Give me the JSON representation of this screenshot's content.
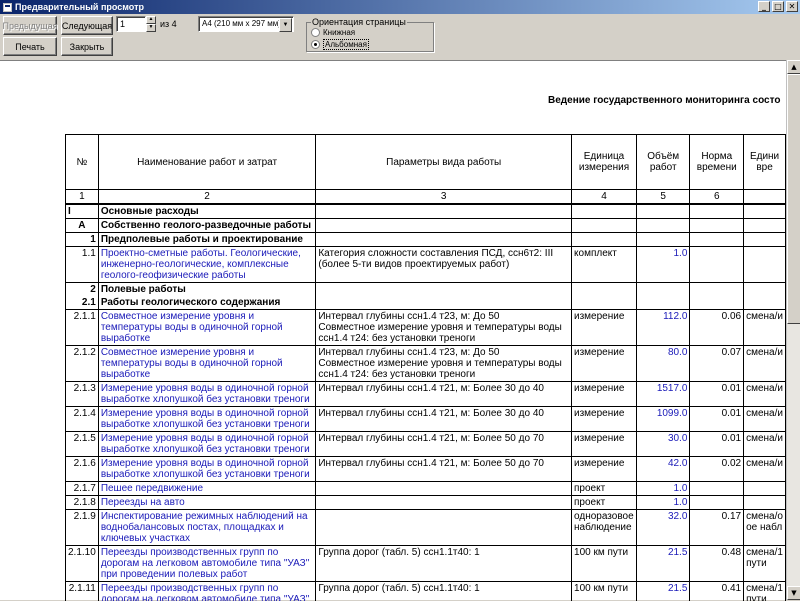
{
  "window": {
    "title": "Предварительный просмотр"
  },
  "toolbar": {
    "prev_label": "Предыдущая",
    "next_label": "Следующая",
    "page_value": "1",
    "page_of": "из 4",
    "paper_size": "А4 (210 мм х 297 мм)",
    "print_label": "Печать",
    "close_label": "Закрыть",
    "orientation_label": "Ориентация страницы",
    "portrait_label": "Книжная",
    "landscape_label": "Альбомная"
  },
  "document": {
    "title": "Ведение государственного мониторинга состо",
    "headers": [
      "№",
      "Наименование работ и затрат",
      "Параметры вида работы",
      "Единица измерения",
      "Объём работ",
      "Норма времени",
      "Едини вре"
    ],
    "col_numbers": [
      "1",
      "2",
      "3",
      "4",
      "5",
      "6",
      ""
    ],
    "rows": [
      {
        "num": "I",
        "name": "Основные расходы",
        "params": "",
        "unit": "",
        "qty": "",
        "norm": "",
        "unit2": "",
        "type": "section",
        "num_align": "left"
      },
      {
        "num": "А",
        "name": "Собственно геолого-разведочные работы",
        "params": "",
        "unit": "",
        "qty": "",
        "norm": "",
        "unit2": "",
        "type": "section",
        "num_align": "center"
      },
      {
        "num": "1",
        "name": "Предполевые работы и проектирование",
        "params": "",
        "unit": "",
        "qty": "",
        "norm": "",
        "unit2": "",
        "type": "section",
        "num_align": "right"
      },
      {
        "num": "1.1",
        "name": "Проектно-сметные работы. Геологические, инженерно-геологические, комплексные геолого-геофизические работы",
        "params": "Категория сложности составления ПСД, ссн6т2: III (более 5-ти видов проектируемых работ)",
        "unit": "комплект",
        "qty": "1.0",
        "norm": "",
        "unit2": "",
        "type": "item",
        "num_align": "right"
      },
      {
        "num": "2",
        "name": "Полевые работы",
        "params": "",
        "unit": "",
        "qty": "",
        "norm": "",
        "unit2": "",
        "type": "section-nb",
        "num_align": "right"
      },
      {
        "num": "2.1",
        "name": "Работы геологического содержания",
        "params": "",
        "unit": "",
        "qty": "",
        "norm": "",
        "unit2": "",
        "type": "section-nt",
        "num_align": "right"
      },
      {
        "num": "2.1.1",
        "name": "Совместное измерение уровня и температуры воды в одиночной горной выработке",
        "params": "Интервал глубины ссн1.4 т23, м: До 50\nСовместное измерение уровня и температуры воды ссн1.4 т24: без установки треноги",
        "unit": "измерение",
        "qty": "112.0",
        "norm": "0.06",
        "unit2": "смена/и",
        "type": "item",
        "num_align": "right"
      },
      {
        "num": "2.1.2",
        "name": "Совместное измерение уровня и температуры воды в одиночной горной выработке",
        "params": "Интервал глубины ссн1.4 т23, м: До 50\nСовместное измерение уровня и температуры воды ссн1.4 т24: без установки треноги",
        "unit": "измерение",
        "qty": "80.0",
        "norm": "0.07",
        "unit2": "смена/и",
        "type": "item",
        "num_align": "right"
      },
      {
        "num": "2.1.3",
        "name": "Измерение уровня воды в одиночной горной выработке хлопушкой без установки треноги",
        "params": "Интервал глубины ссн1.4 т21, м: Более 30 до 40",
        "unit": "измерение",
        "qty": "1517.0",
        "norm": "0.01",
        "unit2": "смена/и",
        "type": "item",
        "num_align": "right"
      },
      {
        "num": "2.1.4",
        "name": "Измерение уровня воды в одиночной горной выработке хлопушкой без установки треноги",
        "params": "Интервал глубины ссн1.4 т21, м: Более 30 до 40",
        "unit": "измерение",
        "qty": "1099.0",
        "norm": "0.01",
        "unit2": "смена/и",
        "type": "item",
        "num_align": "right"
      },
      {
        "num": "2.1.5",
        "name": "Измерение уровня воды в одиночной горной выработке хлопушкой без установки треноги",
        "params": "Интервал глубины ссн1.4 т21, м: Более 50 до 70",
        "unit": "измерение",
        "qty": "30.0",
        "norm": "0.01",
        "unit2": "смена/и",
        "type": "item",
        "num_align": "right"
      },
      {
        "num": "2.1.6",
        "name": "Измерение уровня воды в одиночной горной выработке хлопушкой без установки треноги",
        "params": "Интервал глубины ссн1.4 т21, м: Более 50 до 70",
        "unit": "измерение",
        "qty": "42.0",
        "norm": "0.02",
        "unit2": "смена/и",
        "type": "item",
        "num_align": "right"
      },
      {
        "num": "2.1.7",
        "name": "Пешее передвижение",
        "params": "",
        "unit": "проект",
        "qty": "1.0",
        "norm": "",
        "unit2": "",
        "type": "item",
        "num_align": "right"
      },
      {
        "num": "2.1.8",
        "name": "Переезды на авто",
        "params": "",
        "unit": "проект",
        "qty": "1.0",
        "norm": "",
        "unit2": "",
        "type": "item",
        "num_align": "right"
      },
      {
        "num": "2.1.9",
        "name": "Инспектирование режимных наблюдений на воднобалансовых постах, площадках и ключевых участках",
        "params": "",
        "unit": "одноразовое наблюдение",
        "qty": "32.0",
        "norm": "0.17",
        "unit2": "смена/о ое набл",
        "type": "item",
        "num_align": "right"
      },
      {
        "num": "2.1.10",
        "name": "Переезды производственных групп по дорогам на легковом автомобиле типа \"УАЗ\" при проведении полевых работ",
        "params": "Группа дорог (табл. 5) ссн1.1т40: 1",
        "unit": "100 км пути",
        "qty": "21.5",
        "norm": "0.48",
        "unit2": "смена/1 пути",
        "type": "item",
        "num_align": "right"
      },
      {
        "num": "2.1.11",
        "name": "Переезды производственных групп по дорогам на легковом автомобиле типа \"УАЗ\" при проведении полевых работ",
        "params": "Группа дорог (табл. 5) ссн1.1т40: 1",
        "unit": "100 км пути",
        "qty": "21.5",
        "norm": "0.41",
        "unit2": "смена/1 пути",
        "type": "item",
        "num_align": "right"
      }
    ]
  }
}
